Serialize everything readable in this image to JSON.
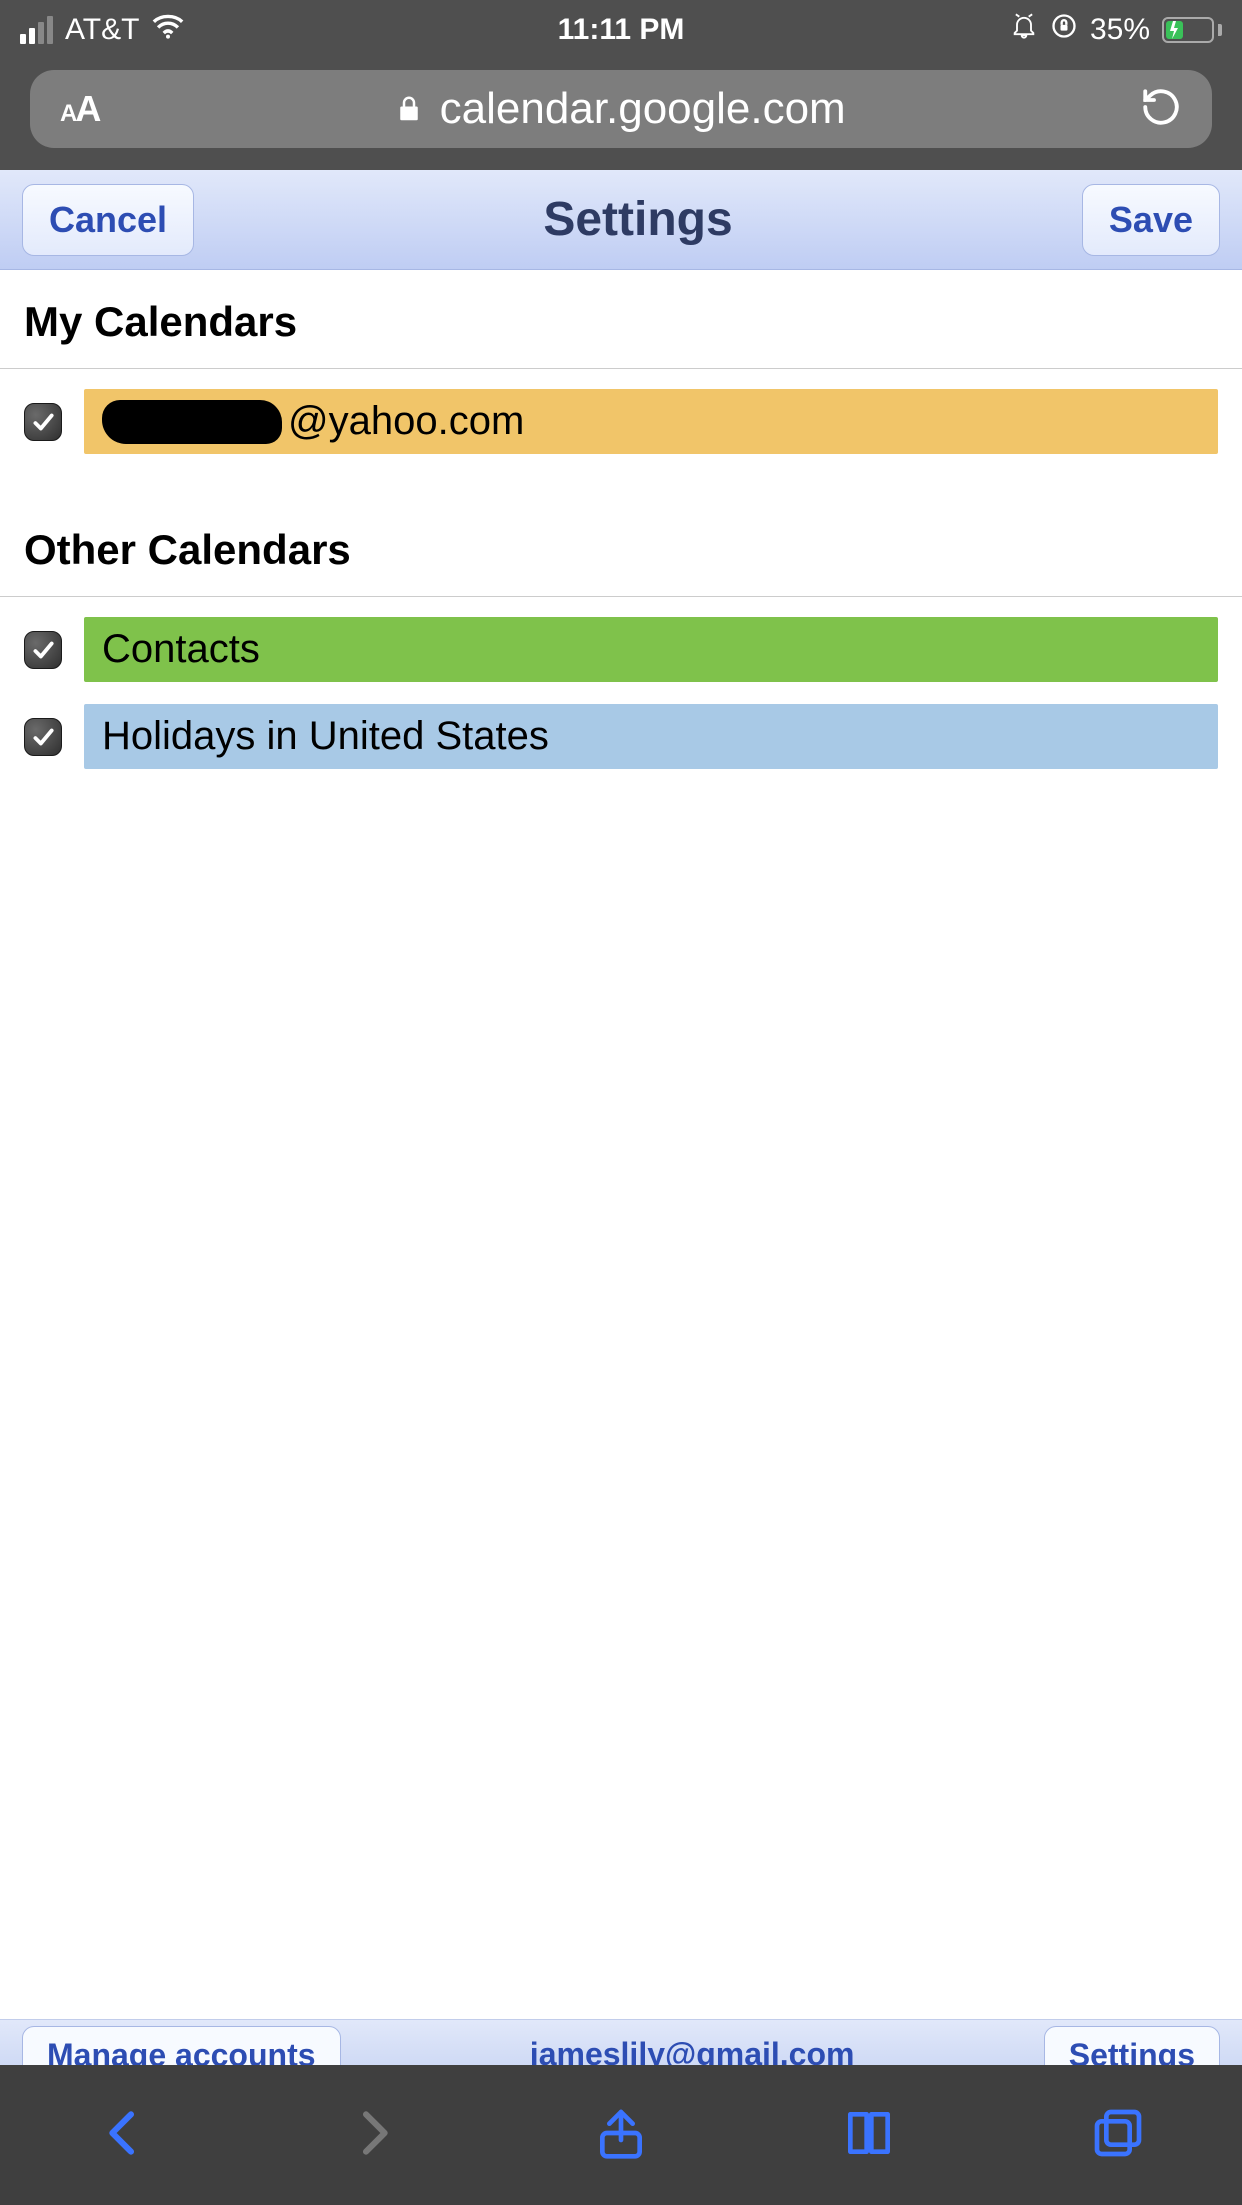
{
  "status_bar": {
    "carrier": "AT&T",
    "time": "11:11 PM",
    "battery_pct": "35%"
  },
  "safari": {
    "url_display": "calendar.google.com"
  },
  "header": {
    "cancel": "Cancel",
    "title": "Settings",
    "save": "Save"
  },
  "sections": {
    "my_calendars_title": "My Calendars",
    "other_calendars_title": "Other Calendars"
  },
  "my_calendars": [
    {
      "label_suffix": "@yahoo.com",
      "color": "#f1c569",
      "checked": true,
      "redacted_prefix": true
    }
  ],
  "other_calendars": [
    {
      "label": "Contacts",
      "color": "#7fc24b",
      "checked": true
    },
    {
      "label": "Holidays in United States",
      "color": "#a8c9e6",
      "checked": true
    }
  ],
  "footer": {
    "manage": "Manage accounts",
    "email": "jameslily@gmail.com",
    "settings": "Settings"
  }
}
